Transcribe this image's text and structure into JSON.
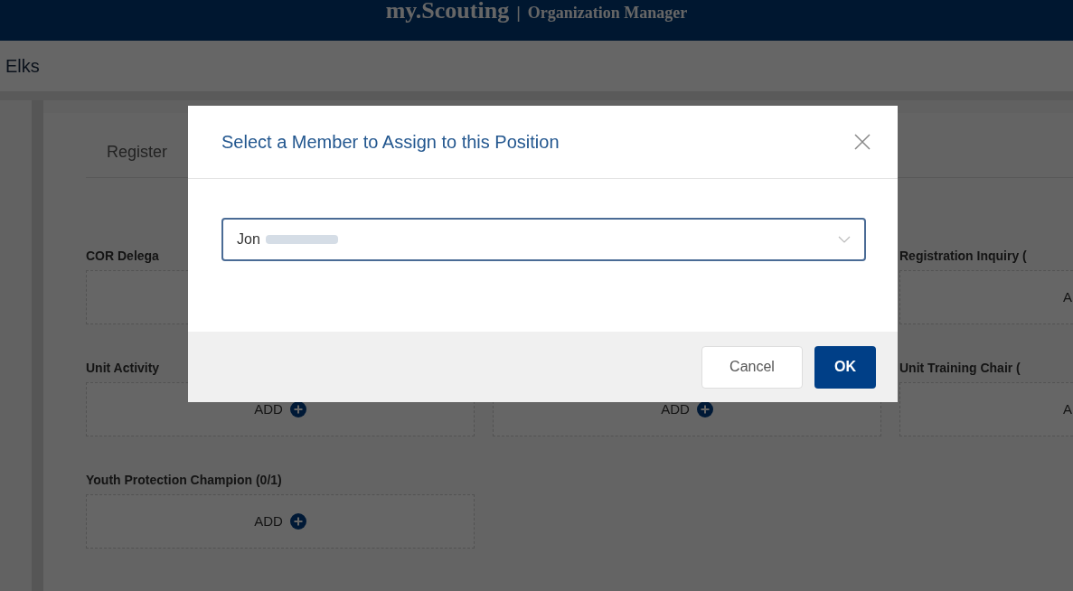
{
  "header": {
    "brand": "my.Scouting",
    "separator": "|",
    "app": "Organization Manager"
  },
  "breadcrumb": "Elks",
  "tab": "Register",
  "positions": [
    {
      "kind": "slot",
      "label": "COR Delega"
    },
    {
      "kind": "covered"
    },
    {
      "kind": "edge",
      "label": "Registration Inquiry (",
      "add": "A"
    },
    {
      "kind": "slot",
      "label": "Unit Activity",
      "add": "ADD"
    },
    {
      "kind": "slot",
      "add": "ADD"
    },
    {
      "kind": "edge",
      "label": "Unit Training Chair (",
      "add": "A"
    },
    {
      "kind": "slot",
      "label": "Youth Protection Champion (0/1)",
      "add": "ADD"
    }
  ],
  "dialog": {
    "title": "Select a Member to Assign to this Position",
    "member_select": {
      "value": "Jon"
    },
    "buttons": [
      {
        "label": "Cancel",
        "kind": "secondary"
      },
      {
        "label": "OK",
        "kind": "primary"
      }
    ]
  }
}
